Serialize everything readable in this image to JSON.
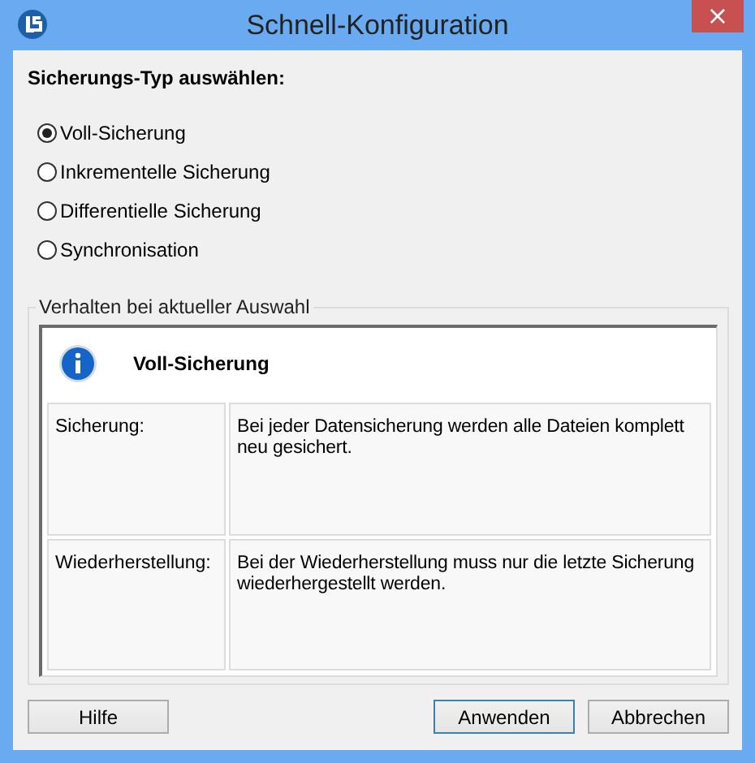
{
  "window": {
    "title": "Schnell-Konfiguration",
    "close": "×"
  },
  "heading": "Sicherungs-Typ auswählen:",
  "options": [
    {
      "label": "Voll-Sicherung",
      "selected": true
    },
    {
      "label": "Inkrementelle Sicherung",
      "selected": false
    },
    {
      "label": "Differentielle Sicherung",
      "selected": false
    },
    {
      "label": "Synchronisation",
      "selected": false
    }
  ],
  "group": {
    "title": "Verhalten bei aktueller Auswahl",
    "header": "Voll-Sicherung",
    "rows": [
      {
        "label": "Sicherung:",
        "text": "Bei jeder Datensicherung werden alle Dateien komplett neu gesichert."
      },
      {
        "label": "Wiederherstellung:",
        "text": "Bei der Wiederherstellung muss nur die letzte Sicherung wiederhergestellt werden."
      }
    ]
  },
  "buttons": [
    {
      "label": "Hilfe",
      "default": false
    },
    {
      "label": "Anwenden",
      "default": true
    },
    {
      "label": "Abbrechen",
      "default": false
    }
  ]
}
